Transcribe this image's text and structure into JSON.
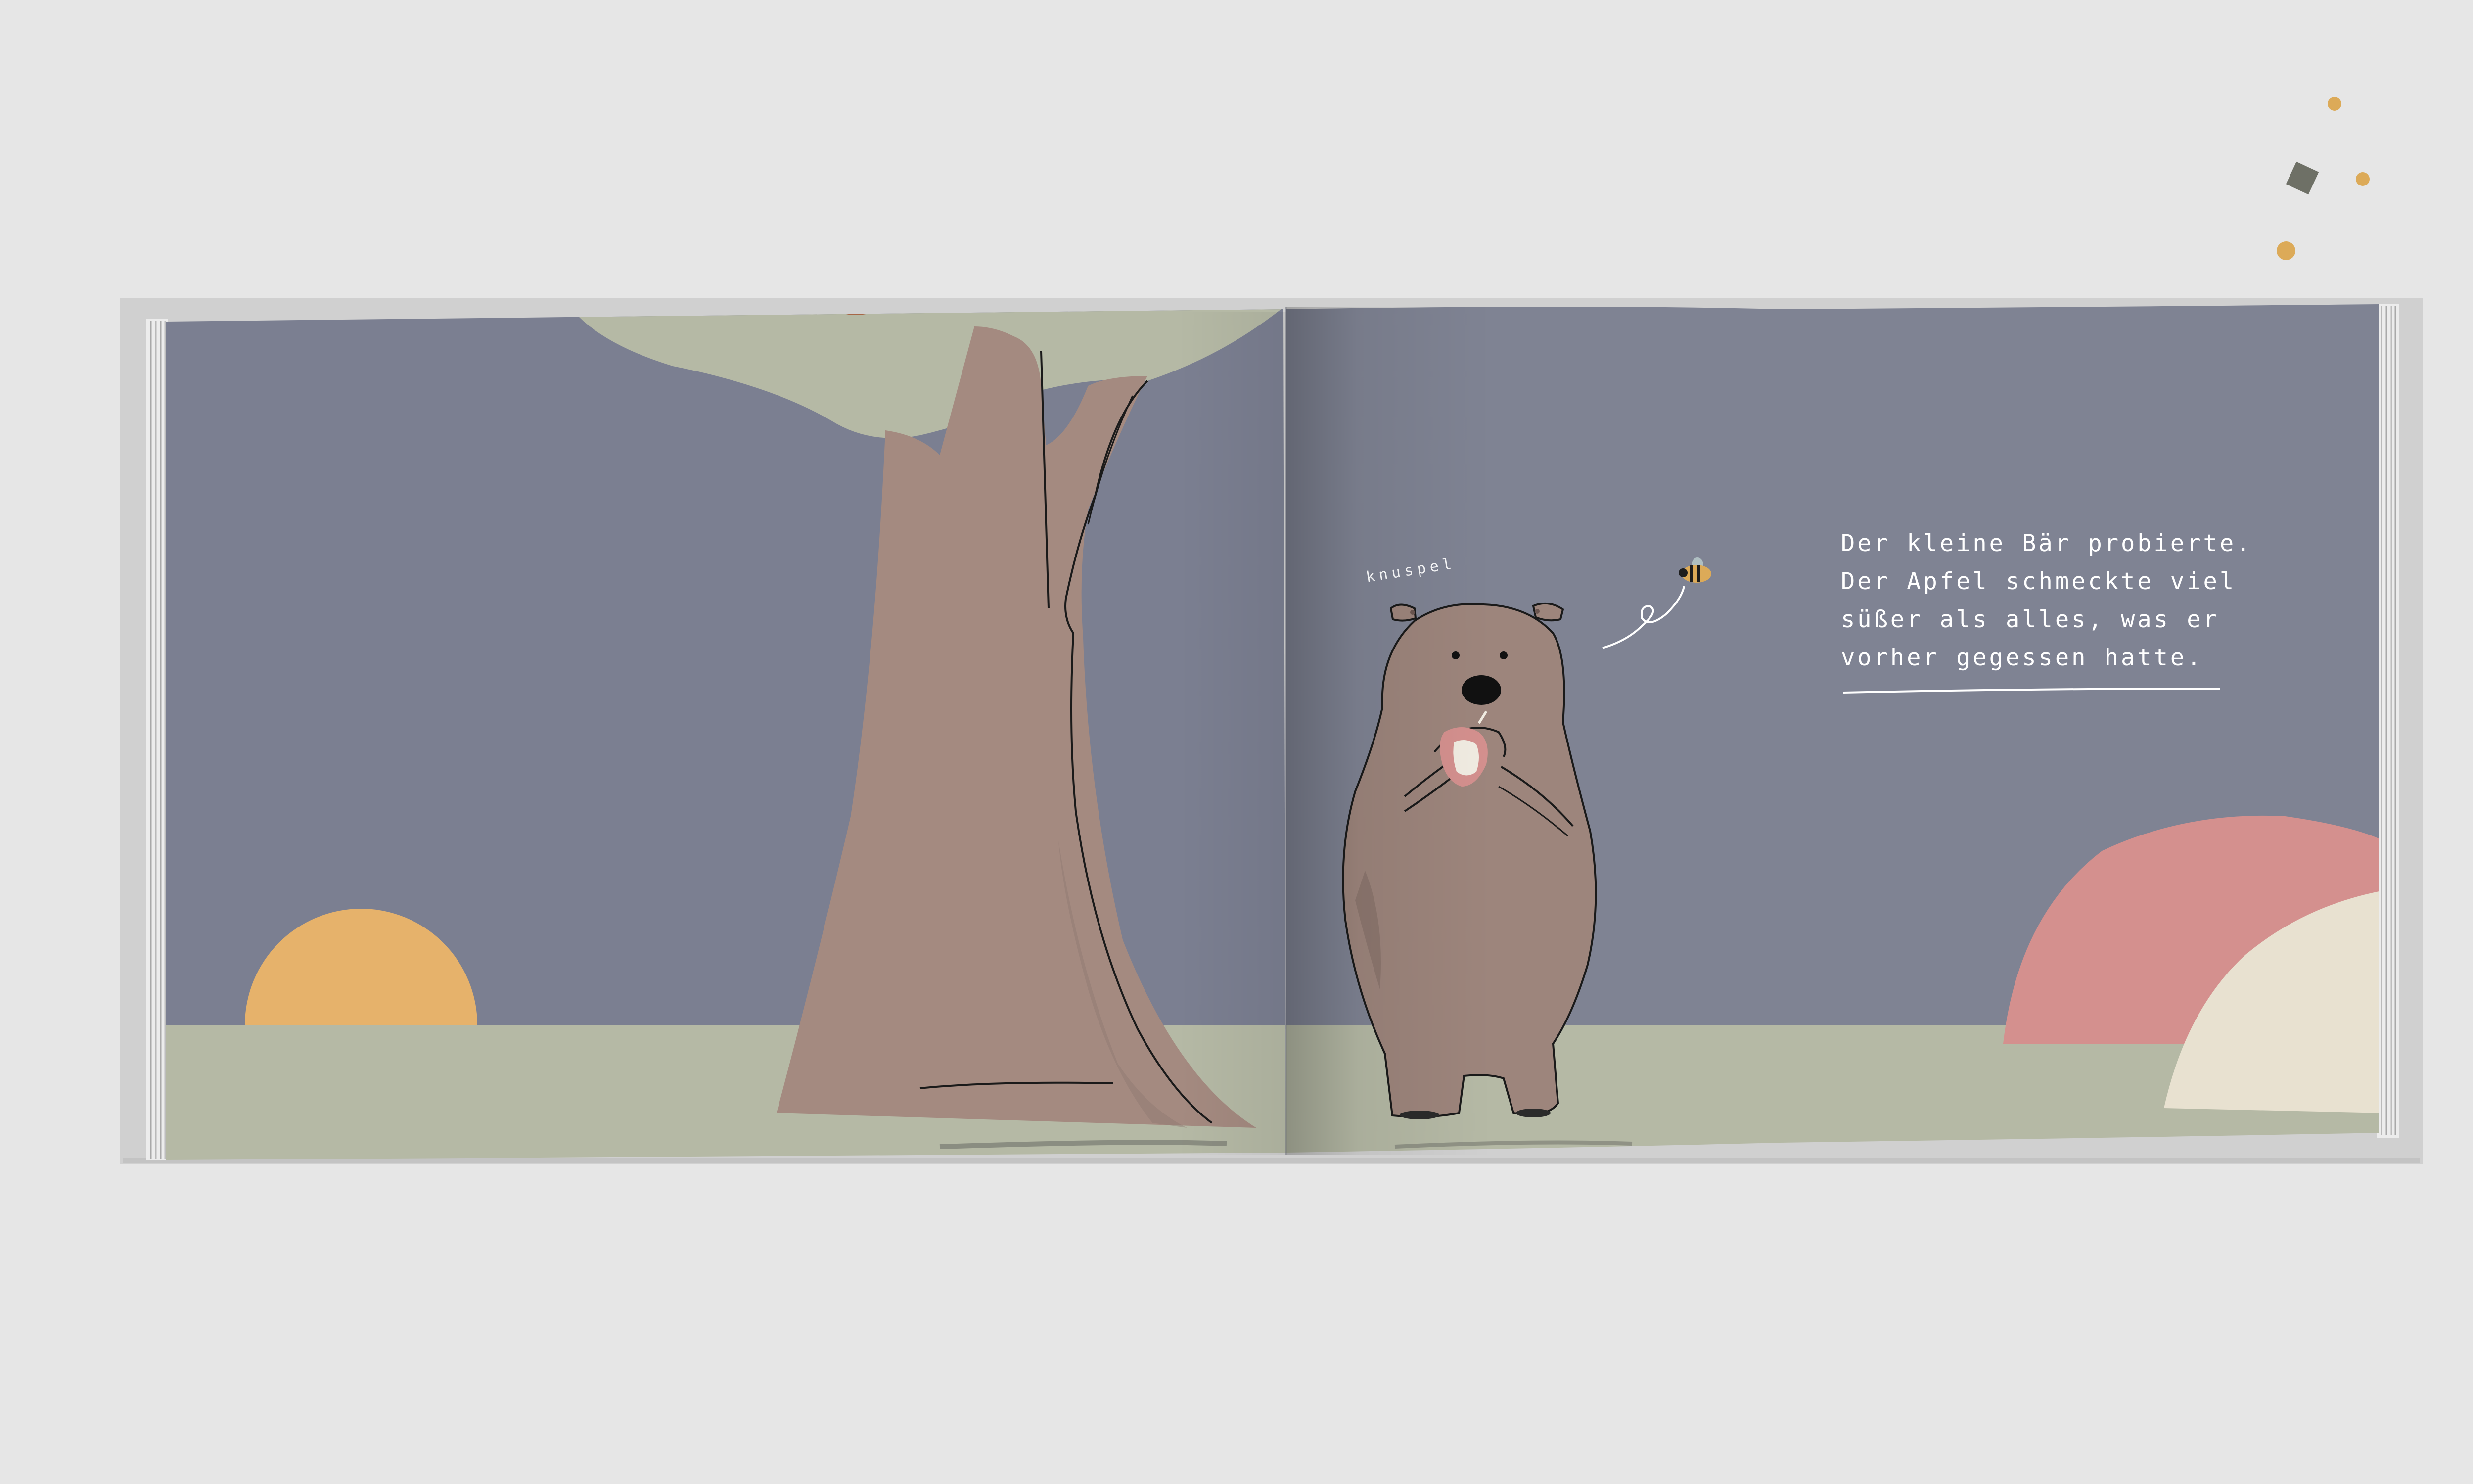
{
  "book": {
    "right_page": {
      "story_lines": [
        "Der kleine Bär probierte.",
        "Der Apfel schmeckte viel",
        "süßer als alles, was er",
        "vorher gegessen hatte."
      ],
      "sound_word": "knuspel"
    }
  },
  "colors": {
    "background": "#e6e6e6",
    "sky": "#7b7f91",
    "ground": "#b5b9a5",
    "tree_trunk": "#a48a80",
    "tree_canopy": "#b5b9a5",
    "bear": "#9d857c",
    "sun": "#e6b26b",
    "hill_pink": "#d4908e",
    "hill_cream": "#e8e1d0",
    "confetti_gold": "#dcaa58",
    "confetti_dark": "#6e7066"
  },
  "icons": [
    "bee-icon",
    "apple-icon",
    "sun-shape",
    "confetti-square",
    "confetti-dot"
  ]
}
